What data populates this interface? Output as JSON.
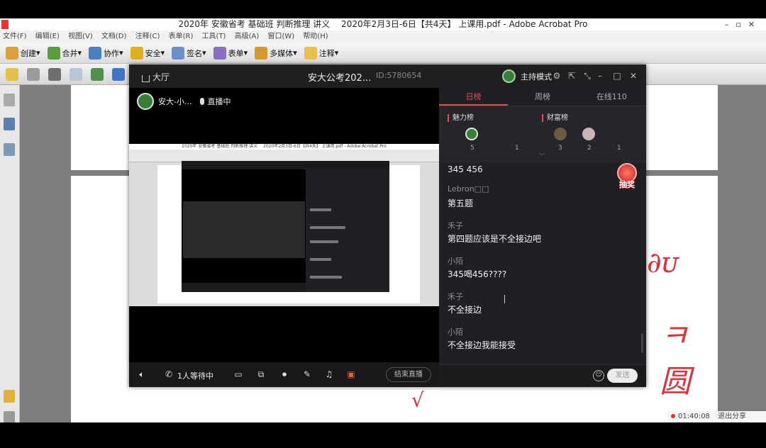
{
  "acrobat": {
    "title": "2020年 安徽省考 基础班 判断推理 讲义　 2020年2月3日-6日【共4天】 上课用.pdf - Adobe Acrobat Pro",
    "menu": [
      "文件(F)",
      "编辑(E)",
      "视图(V)",
      "文档(D)",
      "注释(C)",
      "表单(R)",
      "工具(T)",
      "高级(A)",
      "窗口(W)",
      "帮助(H)"
    ],
    "toolbar": [
      "创建",
      "合并",
      "协作",
      "安全",
      "签名",
      "表单",
      "多媒体",
      "注释"
    ],
    "status_time": "01:40:08",
    "status_right": "退出分享"
  },
  "live": {
    "home_label": "大厅",
    "room_title": "安大公考202...",
    "room_id": "ID:5780654",
    "host_mode": "主持模式",
    "streamer_name": "安大-小...",
    "live_status": "直播中",
    "waiting": "1人等待中",
    "end_live": "结束直播",
    "tabs": [
      "日榜",
      "周榜",
      "在线110"
    ],
    "rank": {
      "charm_label": "魅力榜",
      "wealth_label": "财富榜",
      "charm_nums": [
        "5",
        "1"
      ],
      "wealth_nums": [
        "3",
        "2",
        "1"
      ]
    },
    "chat_top": "345 456",
    "messages": [
      {
        "name": "Lebron□□",
        "text": "第五题"
      },
      {
        "name": "禾子",
        "text": "第四题应该是不全接边吧"
      },
      {
        "name": "小陌",
        "text": "345喝456????"
      },
      {
        "name": "禾子",
        "text": "不全接边"
      },
      {
        "name": "小陌",
        "text": "不全接边我能接受"
      }
    ],
    "lottery": "抽奖",
    "send": "发送"
  },
  "colors": {
    "accent_red": "#e84b4b",
    "panel_bg": "#202024",
    "video_bg": "#000000"
  }
}
